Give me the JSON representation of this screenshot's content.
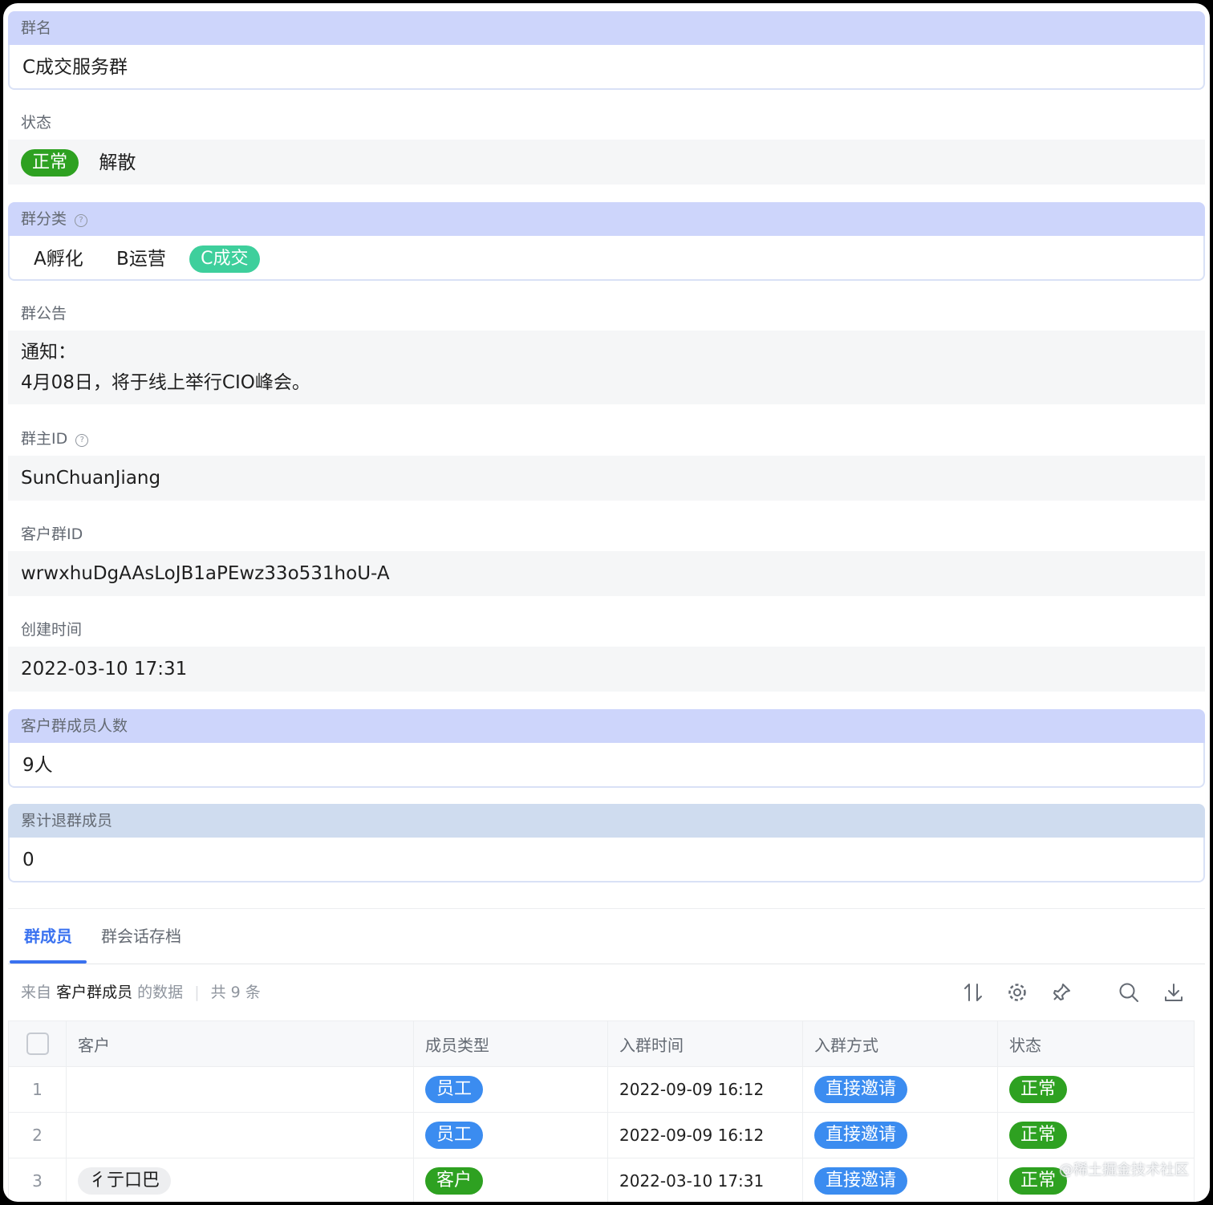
{
  "fields": {
    "name": {
      "label": "群名",
      "value": "C成交服务群"
    },
    "status": {
      "label": "状态",
      "active": "正常",
      "inactive": "解散"
    },
    "category": {
      "label": "群分类",
      "options": [
        "A孵化",
        "B运营"
      ],
      "active": "C成交"
    },
    "notice": {
      "label": "群公告",
      "line1": "通知：",
      "line2": "4月08日，将于线上举行CIO峰会。"
    },
    "owner": {
      "label": "群主ID",
      "value": "SunChuanJiang"
    },
    "group_id": {
      "label": "客户群ID",
      "value": "wrwxhuDgAAsLoJB1aPEwz33o531hoU-A"
    },
    "created": {
      "label": "创建时间",
      "value": "2022-03-10 17:31"
    },
    "member_count": {
      "label": "客户群成员人数",
      "value": "9人"
    },
    "left_count": {
      "label": "累计退群成员",
      "value": "0"
    }
  },
  "tabs": [
    "群成员",
    "群会话存档"
  ],
  "toolbar": {
    "from": "来自",
    "source": "客户群成员",
    "suffix": "的数据",
    "total": "共 9 条",
    "icons": [
      "sort-icon",
      "gear-icon",
      "pin-icon",
      "search-icon",
      "download-icon"
    ]
  },
  "table": {
    "headers": [
      "客户",
      "成员类型",
      "入群时间",
      "入群方式",
      "状态"
    ],
    "rows": [
      {
        "idx": "1",
        "customer": "",
        "type": "员工",
        "time": "2022-09-09 16:12",
        "method": "直接邀请",
        "status": "正常"
      },
      {
        "idx": "2",
        "customer": "",
        "type": "员工",
        "time": "2022-09-09 16:12",
        "method": "直接邀请",
        "status": "正常"
      },
      {
        "idx": "3",
        "customer": "彳亍口巴",
        "type": "客户",
        "time": "2022-03-10 17:31",
        "method": "直接邀请",
        "status": "正常"
      }
    ]
  },
  "watermark": "@稀土掘金技术社区",
  "colors": {
    "label_highlight": "#cdd5fb",
    "accent": "#3a72f0",
    "green": "#2ea121",
    "teal": "#3ecf9c",
    "blue": "#3b8cf0"
  }
}
